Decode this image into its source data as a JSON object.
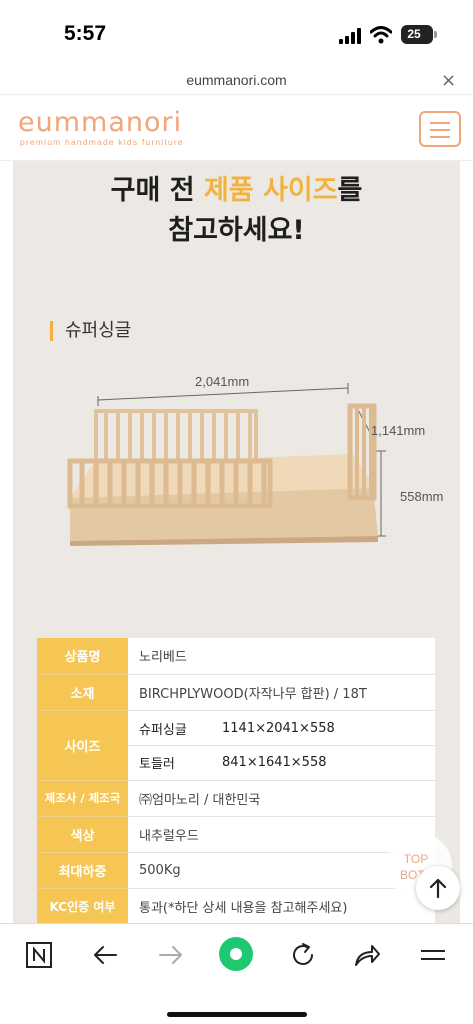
{
  "status_bar": {
    "time": "5:57",
    "battery": "25"
  },
  "browser": {
    "url": "eummanori.com"
  },
  "site": {
    "logo": "eummanori",
    "tagline": "premium handmade kids furniture"
  },
  "headline": {
    "prefix": "구매 전 ",
    "highlight": "제품 사이즈",
    "suffix": "를",
    "line2": "참고하세요!"
  },
  "section_title": "슈퍼싱글",
  "dimensions": {
    "width": "2,041mm",
    "depth": "1,141mm",
    "height": "558mm"
  },
  "specs": {
    "product_name_label": "상품명",
    "product_name": "노리베드",
    "material_label": "소재",
    "material": "BIRCHPLYWOOD(자작나무 합판) / 18T",
    "size_label": "사이즈",
    "sizes": [
      {
        "name": "슈퍼싱글",
        "value": "1141×2041×558"
      },
      {
        "name": "토들러",
        "value": "841×1641×558"
      }
    ],
    "maker_label": "제조사 / 제조국",
    "maker": "㈜엄마노리 / 대한민국",
    "color_label": "색상",
    "color": "내추럴우드",
    "max_load_label": "최대하중",
    "max_load": "500Kg",
    "kc_label": "KC인증 여부",
    "kc": "통과(*하단 상세 내용을 참고해주세요)"
  },
  "float": {
    "top_line1": "TOP",
    "top_line2": "BOTT"
  },
  "colors": {
    "brand": "#f0a57a",
    "accent": "#f1b23f",
    "table_header": "#f6c654",
    "browser_green": "#1ec870"
  },
  "icons": [
    "n-tab-icon",
    "back-arrow-icon",
    "forward-arrow-icon",
    "home-circle-icon",
    "refresh-icon",
    "share-icon",
    "menu-icon",
    "up-arrow-icon",
    "close-icon",
    "hamburger-icon"
  ]
}
